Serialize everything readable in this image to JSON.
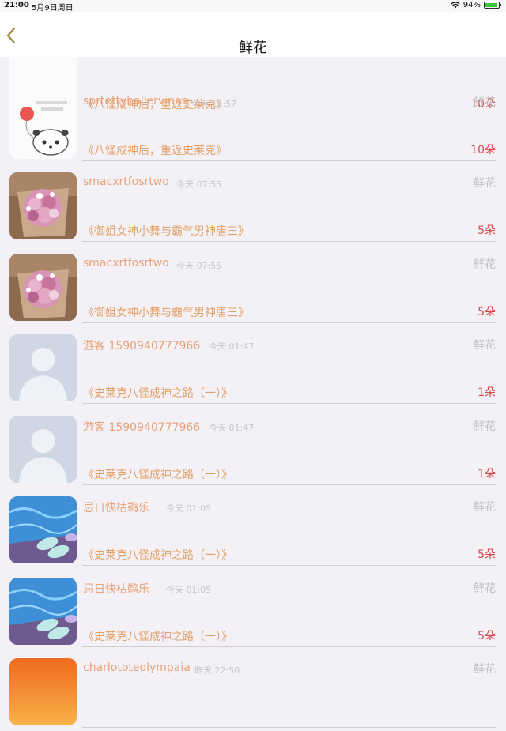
{
  "status_bar": {
    "time": "21:00",
    "date": "5月9日周日",
    "battery_text": "94%",
    "battery_level": 0.94
  },
  "nav": {
    "title": "鲜花",
    "back_icon": "chevron-left-icon"
  },
  "rows": [
    {
      "avatar": "panda-sticker",
      "name": "",
      "time": "",
      "type": "",
      "book": "《八怪成神后，重返史莱克》",
      "count": "10朵"
    },
    {
      "avatar": "panda-balloon",
      "name": "sprtettyballervinas",
      "time": "今天 11:57",
      "type": "鲜花",
      "book": "《八怪成神后，重返史莱克》",
      "count": "10朵"
    },
    {
      "avatar": "flower-bouquet",
      "name": "smacxrtfosrtwo",
      "time": "今天 07:55",
      "type": "鲜花",
      "book": "《御姐女神小舞与霸气男神唐三》",
      "count": "5朵"
    },
    {
      "avatar": "flower-bouquet",
      "name": "smacxrtfosrtwo",
      "time": "今天 07:55",
      "type": "鲜花",
      "book": "《御姐女神小舞与霸气男神唐三》",
      "count": "5朵"
    },
    {
      "avatar": "default-user",
      "name": "游客 1590940777966",
      "time": "今天 01:47",
      "type": "鲜花",
      "book": "《史莱克八怪成神之路（一）》",
      "count": "1朵"
    },
    {
      "avatar": "default-user",
      "name": "游客 1590940777966",
      "time": "今天 01:47",
      "type": "鲜花",
      "book": "《史莱克八怪成神之路（一）》",
      "count": "1朵"
    },
    {
      "avatar": "pool-slippers",
      "name": "忌日快枯鹈乐",
      "time": "今天 01:05",
      "type": "鲜花",
      "book": "《史莱克八怪成神之路（一）》",
      "count": "5朵"
    },
    {
      "avatar": "pool-slippers",
      "name": "忌日快枯鹈乐",
      "time": "今天 01:05",
      "type": "鲜花",
      "book": "《史莱克八怪成神之路（一）》",
      "count": "5朵"
    },
    {
      "avatar": "sunset-sky",
      "name": "charlototeolympaia",
      "time": "昨天 22:50",
      "type": "鲜花",
      "book": "",
      "count": ""
    }
  ]
}
